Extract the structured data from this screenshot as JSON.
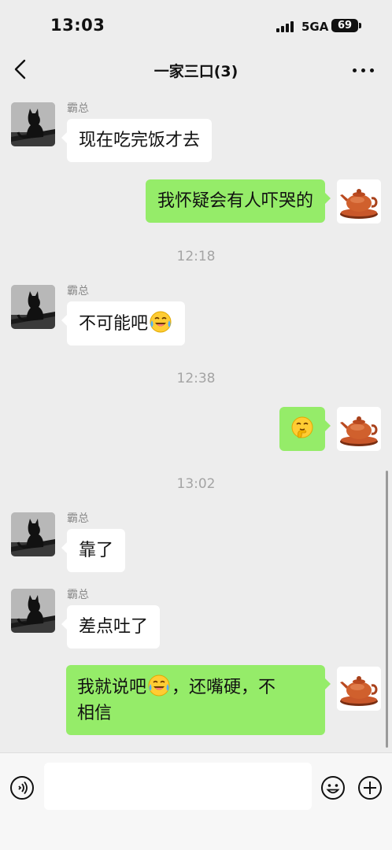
{
  "status_bar": {
    "time": "13:03",
    "network": "5GA",
    "battery": "69"
  },
  "header": {
    "title": "一家三口(3)"
  },
  "messages": {
    "m1": {
      "sender": "霸总",
      "text": "现在吃完饭才去"
    },
    "m2": {
      "text": "我怀疑会有人吓哭的"
    },
    "t1": "12:18",
    "m3": {
      "sender": "霸总",
      "text": "不可能吧",
      "emoji": "crying-laughing-emoji"
    },
    "t2": "12:38",
    "m4": {
      "emoji": "giggle-emoji"
    },
    "t3": "13:02",
    "m5": {
      "sender": "霸总",
      "text": "靠了"
    },
    "m6": {
      "sender": "霸总",
      "text": "差点吐了"
    },
    "m7": {
      "text_before": "我就说吧",
      "emoji": "crying-laughing-emoji",
      "text_after": "，还嘴硬，不",
      "text_line2": "相信"
    }
  },
  "avatars": {
    "incoming": "black-cat-avatar",
    "outgoing": "teapot-avatar"
  },
  "input_bar": {
    "placeholder": ""
  },
  "colors": {
    "background": "#ededed",
    "outgoing_bubble": "#95ec69",
    "incoming_bubble": "#ffffff"
  }
}
